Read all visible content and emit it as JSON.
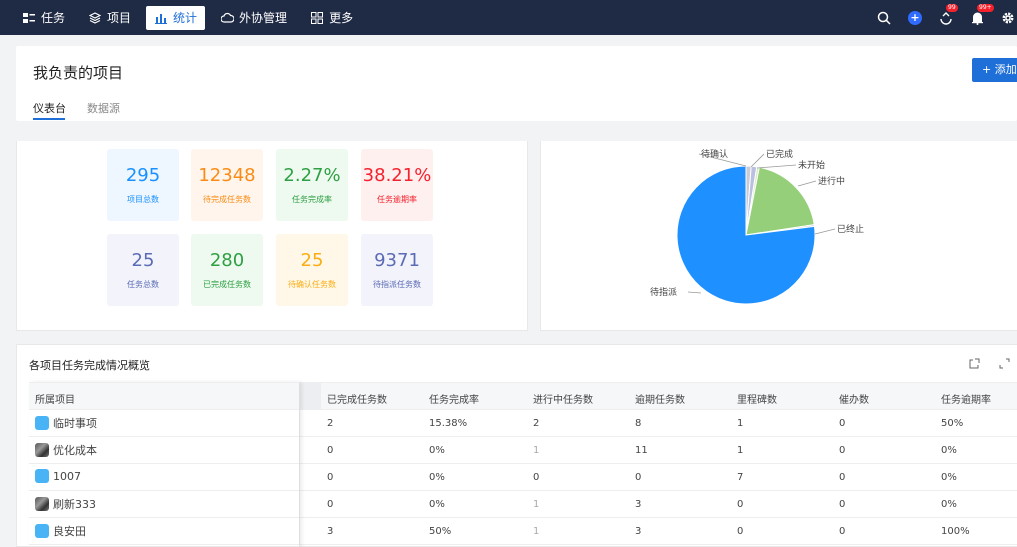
{
  "nav": {
    "items": [
      {
        "label": "任务",
        "icon": "task-icon",
        "active": false
      },
      {
        "label": "项目",
        "icon": "layers-icon",
        "active": false
      },
      {
        "label": "统计",
        "icon": "bar-chart-icon",
        "active": true
      },
      {
        "label": "外协管理",
        "icon": "cloud-icon",
        "active": false
      },
      {
        "label": "更多",
        "icon": "grid-icon",
        "active": false
      }
    ],
    "right_icons": [
      "search-icon",
      "add-circle-icon",
      "sync-icon",
      "bell-icon",
      "gear-icon"
    ],
    "badges": {
      "sync": "99",
      "bell": "99+"
    }
  },
  "header": {
    "title": "我负责的项目",
    "add_button": "+ 添加",
    "tabs": [
      {
        "label": "仪表台",
        "active": true
      },
      {
        "label": "数据源",
        "active": false
      }
    ]
  },
  "stats": [
    {
      "value": "295",
      "label": "项目总数",
      "color": "#1890ff",
      "bg": "#eef6ff"
    },
    {
      "value": "12348",
      "label": "待完成任务数",
      "color": "#fa8c16",
      "bg": "#fff5ec"
    },
    {
      "value": "2.27%",
      "label": "任务完成率",
      "color": "#2ea043",
      "bg": "#eefaf0"
    },
    {
      "value": "38.21%",
      "label": "任务逾期率",
      "color": "#f5222d",
      "bg": "#fff0f0"
    },
    {
      "value": "25",
      "label": "任务总数",
      "color": "#5b6bb5",
      "bg": "#f2f3fb"
    },
    {
      "value": "280",
      "label": "已完成任务数",
      "color": "#2ea043",
      "bg": "#eefaf0"
    },
    {
      "value": "25",
      "label": "待确认任务数",
      "color": "#faad14",
      "bg": "#fff8e8"
    },
    {
      "value": "9371",
      "label": "待指派任务数",
      "color": "#5b6bb5",
      "bg": "#f2f3fb"
    }
  ],
  "chart_data": {
    "type": "pie",
    "slices": [
      {
        "label": "待确认",
        "value": 1.2,
        "color": "#c9cbd6"
      },
      {
        "label": "已完成",
        "value": 1.3,
        "color": "#b9c0e0"
      },
      {
        "label": "未开始",
        "value": 0.6,
        "color": "#d8ebc4"
      },
      {
        "label": "进行中",
        "value": 19.5,
        "color": "#95cf7a"
      },
      {
        "label": "已终止",
        "value": 0.4,
        "color": "#cfd3e6"
      },
      {
        "label": "待指派",
        "value": 77.0,
        "color": "#1e90ff"
      }
    ]
  },
  "table": {
    "title": "各项目任务完成情况概览",
    "columns": [
      "所属项目",
      "已完成任务数",
      "任务完成率",
      "进行中任务数",
      "逾期任务数",
      "里程碑数",
      "催办数",
      "任务逾期率"
    ],
    "rows": [
      {
        "name": "临时事项",
        "icon": "blue",
        "cells": [
          "2",
          "15.38%",
          "2",
          "8",
          "1",
          "0",
          "50%"
        ]
      },
      {
        "name": "优化成本",
        "icon": "photo",
        "cells": [
          "0",
          "0%",
          "1",
          "11",
          "1",
          "0",
          "0%"
        ]
      },
      {
        "name": "1007",
        "icon": "blue",
        "cells": [
          "0",
          "0%",
          "0",
          "0",
          "7",
          "0",
          "0%"
        ]
      },
      {
        "name": "刷新333",
        "icon": "photo",
        "cells": [
          "0",
          "0%",
          "1",
          "3",
          "0",
          "0",
          "0%"
        ]
      },
      {
        "name": "良安田",
        "icon": "blue",
        "cells": [
          "3",
          "50%",
          "1",
          "3",
          "0",
          "0",
          "100%"
        ]
      }
    ]
  }
}
